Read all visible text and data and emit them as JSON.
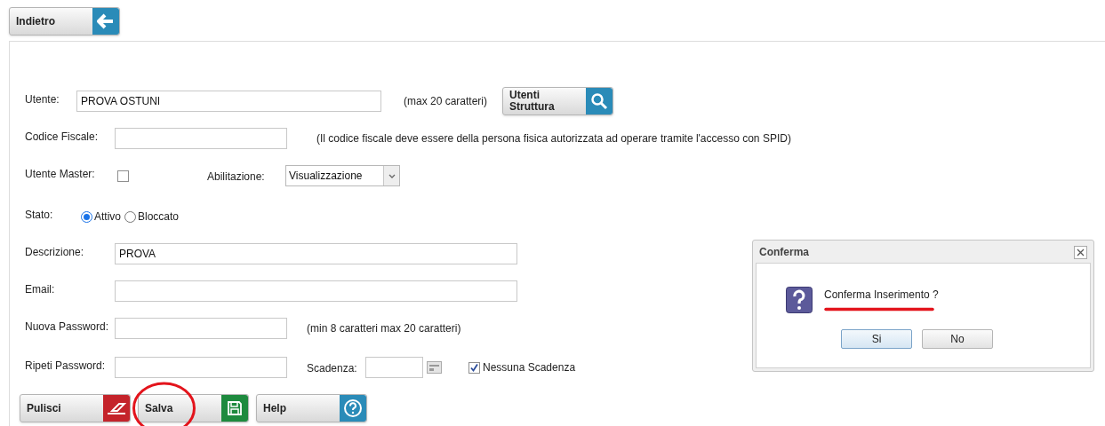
{
  "back_button": {
    "label": "Indietro"
  },
  "form": {
    "utente": {
      "label": "Utente:",
      "value": "PROVA OSTUNI",
      "hint": "(max 20 caratteri)",
      "lookup_button": "Utenti Struttura"
    },
    "codice_fiscale": {
      "label": "Codice Fiscale:",
      "hint": "(Il codice fiscale deve essere della persona fisica autorizzata ad operare tramite l'accesso con SPID)"
    },
    "utente_master": {
      "label": "Utente Master:",
      "checked": false
    },
    "abilitazione": {
      "label": "Abilitazione:",
      "value": "Visualizzazione"
    },
    "stato": {
      "label": "Stato:",
      "options": [
        {
          "label": "Attivo",
          "selected": true
        },
        {
          "label": "Bloccato",
          "selected": false
        }
      ]
    },
    "descrizione": {
      "label": "Descrizione:",
      "value": "PROVA"
    },
    "email": {
      "label": "Email:"
    },
    "nuova_password": {
      "label": "Nuova Password:",
      "hint": "(min 8 caratteri max 20 caratteri)"
    },
    "ripeti_password": {
      "label": "Ripeti Password:"
    },
    "scadenza": {
      "label": "Scadenza:"
    },
    "nessuna_scadenza": {
      "label": "Nessuna Scadenza",
      "checked": true
    }
  },
  "actions": [
    {
      "label": "Pulisci",
      "kind": "clear",
      "circled": false
    },
    {
      "label": "Salva",
      "kind": "save",
      "circled": true
    },
    {
      "label": "Help",
      "kind": "help",
      "circled": false
    }
  ],
  "dialog": {
    "title": "Conferma",
    "message": "Conferma Inserimento ?",
    "message_underlined": true,
    "buttons": [
      {
        "label": "Si",
        "focused": true
      },
      {
        "label": "No",
        "focused": false
      }
    ]
  }
}
